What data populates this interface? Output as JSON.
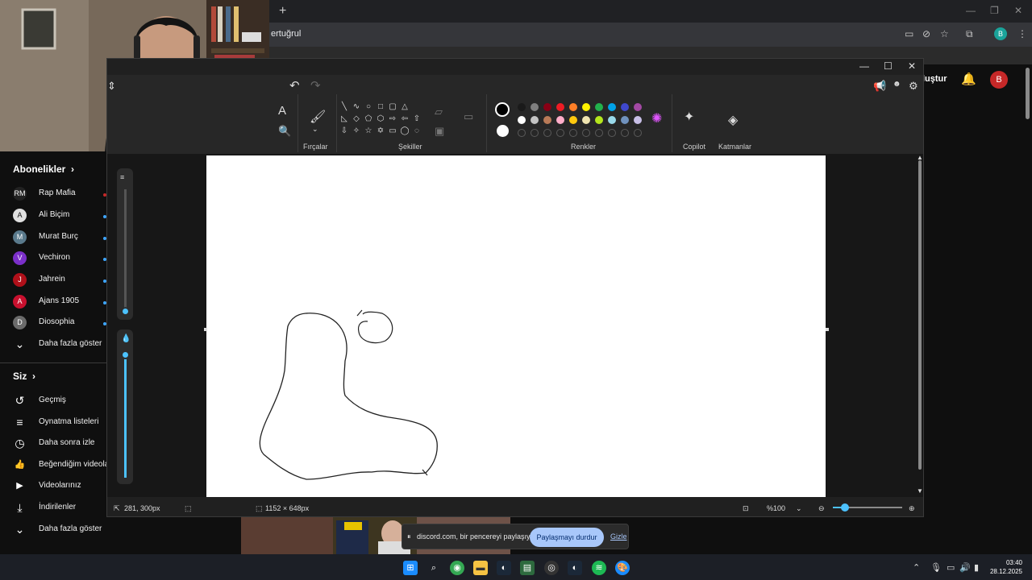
{
  "browser": {
    "new_tab": "+",
    "address_fragment": "ertuğrul",
    "profile_initial": "B",
    "window_controls": [
      "—",
      "❐",
      "✕"
    ]
  },
  "youtube": {
    "create_label": "luştur",
    "avatar_initial": "B",
    "subscriptions_title": "Abonelikler",
    "subscriptions": [
      {
        "name": "Rap Mafia",
        "color": "#222222",
        "initial": "RM"
      },
      {
        "name": "Ali Biçim",
        "color": "#e0e0e0",
        "initial": "A"
      },
      {
        "name": "Murat Burç",
        "color": "#5a7a8c",
        "initial": "M"
      },
      {
        "name": "Vechiron",
        "color": "#7b2fc9",
        "initial": "V"
      },
      {
        "name": "Jahrein",
        "color": "#b0101a",
        "initial": "J"
      },
      {
        "name": "Ajans 1905",
        "color": "#c8102e",
        "initial": "A"
      },
      {
        "name": "Diosophia",
        "color": "#6b6b6b",
        "initial": "D"
      }
    ],
    "show_more": "Daha fazla göster",
    "you_title": "Siz",
    "you_items": [
      {
        "label": "Geçmiş",
        "icon": "history-icon",
        "glyph": "↺"
      },
      {
        "label": "Oynatma listeleri",
        "icon": "playlist-icon",
        "glyph": "≡"
      },
      {
        "label": "Daha sonra izle",
        "icon": "clock-icon",
        "glyph": "◷"
      },
      {
        "label": "Beğendiğim videolar",
        "icon": "thumb-up-icon",
        "glyph": "👍"
      },
      {
        "label": "Videolarınız",
        "icon": "video-icon",
        "glyph": "▶"
      },
      {
        "label": "İndirilenler",
        "icon": "download-icon",
        "glyph": "⤓"
      }
    ],
    "show_more_2": "Daha fazla göster"
  },
  "paint": {
    "groups": {
      "brushes": "Fırçalar",
      "shapes": "Şekiller",
      "colors": "Renkler",
      "copilot": "Copilot",
      "layers": "Katmanlar"
    },
    "palette_row1": [
      "#1a1a1a",
      "#7f7f7f",
      "#880015",
      "#ed1c24",
      "#ff7f27",
      "#fff200",
      "#22b14c",
      "#00a2e8",
      "#3f48cc",
      "#a349a4"
    ],
    "palette_row2": [
      "#ffffff",
      "#c3c3c3",
      "#b97a57",
      "#ffaec9",
      "#ffc90e",
      "#efe4b0",
      "#b5e61d",
      "#99d9ea",
      "#7092be",
      "#c8bfe7"
    ],
    "primary_color": "#000000",
    "secondary_color": "#ffffff",
    "status": {
      "cursor_pos": "281, 300px",
      "canvas_size": "1152 × 648px",
      "zoom": "%100"
    }
  },
  "share": {
    "text": "discord.com, bir pencereyi paylaşıyor.",
    "stop_label": "Paylaşmayı durdur",
    "hide_label": "Gizle"
  },
  "taskbar": {
    "time": "03:40",
    "date": "28.12.2025"
  }
}
